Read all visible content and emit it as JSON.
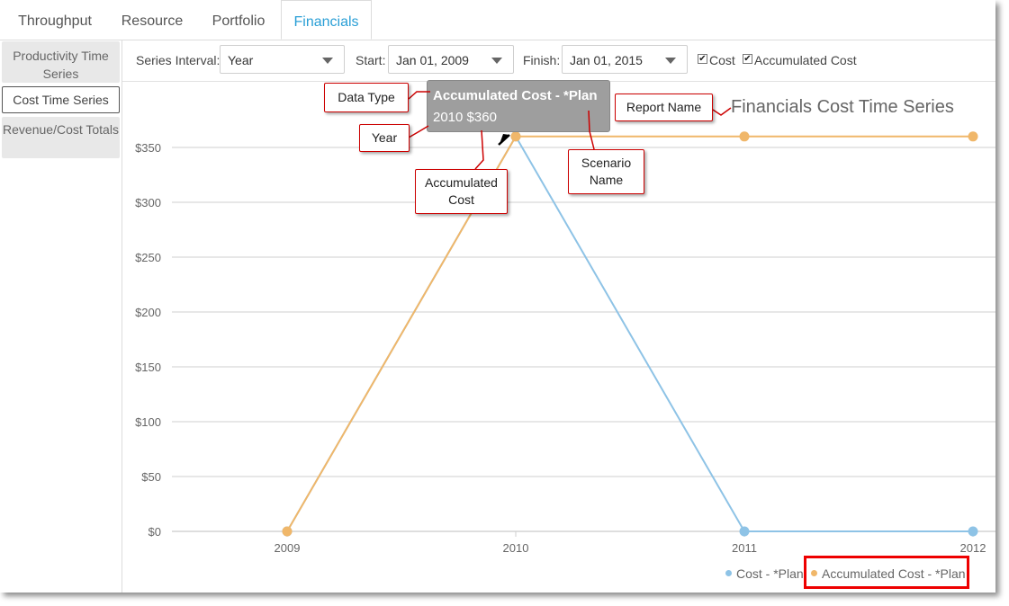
{
  "tabs": [
    {
      "label": "Throughput"
    },
    {
      "label": "Resource"
    },
    {
      "label": "Portfolio"
    },
    {
      "label": "Financials",
      "active": true
    }
  ],
  "sidebar": {
    "items": [
      {
        "label": "Productivity Time Series"
      },
      {
        "label": "Cost Time Series",
        "active": true
      },
      {
        "label": "Revenue/Cost Totals"
      }
    ]
  },
  "toolbar": {
    "interval_label": "Series Interval:",
    "interval_value": "Year",
    "start_label": "Start:",
    "start_value": "Jan 01, 2009",
    "finish_label": "Finish:",
    "finish_value": "Jan 01, 2015",
    "cost_label": "Cost",
    "cost_checked": true,
    "acc_cost_label": "Accumulated Cost",
    "acc_cost_checked": true
  },
  "chart_title": "Financials Cost Time Series",
  "tooltip": {
    "series": "Accumulated Cost - *Plan",
    "value_line": "2010 $360"
  },
  "callouts": {
    "data_type": "Data Type",
    "year": "Year",
    "accumulated_cost": "Accumulated Cost",
    "scenario_name": "Scenario Name",
    "report_name": "Report Name"
  },
  "colors": {
    "cost": "#8ec3e6",
    "accumulated_cost": "#f0b76a",
    "accent": "#2a9fd6",
    "callout_border": "#cc0000"
  },
  "chart_data": {
    "type": "line",
    "title": "Financials Cost Time Series",
    "x": [
      "2009",
      "2010",
      "2011",
      "2012"
    ],
    "ylim": [
      0,
      375
    ],
    "yticks": [
      "$0",
      "$50",
      "$100",
      "$150",
      "$200",
      "$250",
      "$300",
      "$350"
    ],
    "ytick_values": [
      0,
      50,
      100,
      150,
      200,
      250,
      300,
      350
    ],
    "grid": true,
    "legend_position": "bottom-right",
    "series": [
      {
        "name": "Cost - *Plan",
        "values": [
          0,
          360,
          0,
          0
        ]
      },
      {
        "name": "Accumulated Cost - *Plan",
        "values": [
          0,
          360,
          360,
          360
        ]
      }
    ]
  }
}
